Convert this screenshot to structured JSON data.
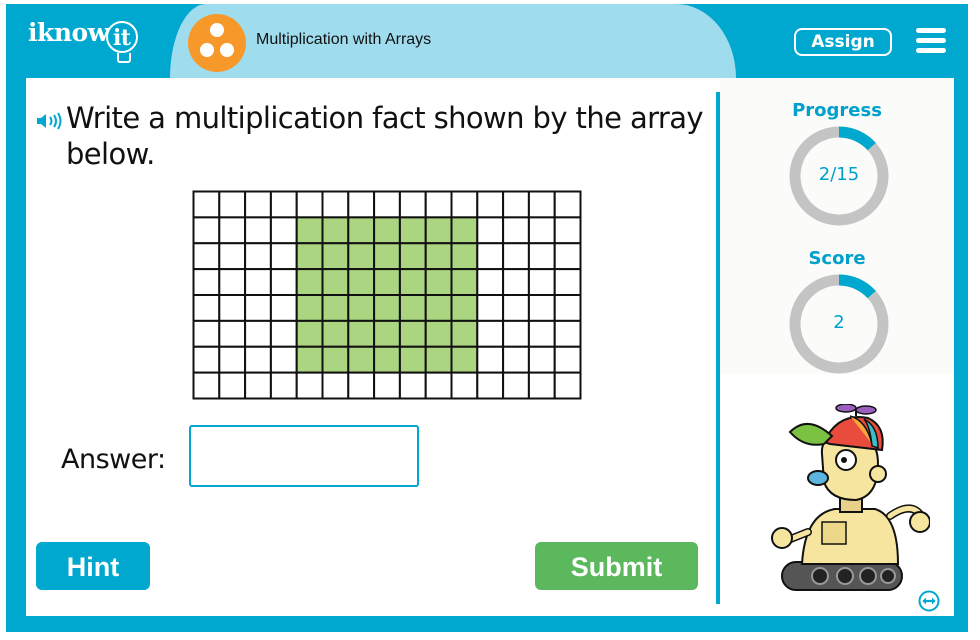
{
  "header": {
    "logo_text": "iknow",
    "logo_bulb_text": "it",
    "lesson_title": "Multiplication with Arrays",
    "assign_label": "Assign",
    "menu_icon": "hamburger-menu-icon",
    "lesson_icon": "three-dots-circle-icon"
  },
  "question": {
    "audio_icon": "speaker-icon",
    "text": "Write a multiplication fact shown by the array below."
  },
  "array": {
    "grid_rows": 8,
    "grid_cols": 15,
    "shaded_rows": 6,
    "shaded_cols": 7,
    "shaded_row_start": 1,
    "shaded_col_start": 4,
    "shade_color": "#acd581",
    "line_color": "#111111"
  },
  "answer": {
    "label": "Answer:",
    "value": "",
    "placeholder": ""
  },
  "buttons": {
    "hint_label": "Hint",
    "submit_label": "Submit"
  },
  "sidebar": {
    "progress": {
      "label": "Progress",
      "text": "2/15",
      "fraction": 0.1333
    },
    "score": {
      "label": "Score",
      "text": "2",
      "fraction": 0.1333
    },
    "mascot": "robot-mascot",
    "swap_icon": "swap-arrows-icon"
  },
  "colors": {
    "brand_blue": "#00a8cf",
    "title_bg": "#9fdcee",
    "lesson_orange": "#f7992a",
    "submit_green": "#5cb85c",
    "ring_gray": "#c4c4c4"
  }
}
